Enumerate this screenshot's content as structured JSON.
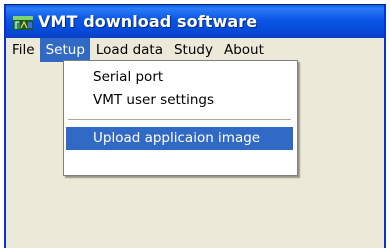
{
  "window": {
    "title": "VMT download software",
    "icon": "app-icon"
  },
  "menubar": {
    "items": [
      {
        "label": "File"
      },
      {
        "label": "Setup"
      },
      {
        "label": "Load data"
      },
      {
        "label": "Study"
      },
      {
        "label": "About"
      }
    ],
    "active": "Setup"
  },
  "setup_menu": {
    "items": [
      {
        "label": "Serial port"
      },
      {
        "label": "VMT user settings"
      },
      {
        "label": "Upload applicaion image"
      }
    ],
    "highlighted": "Upload applicaion image"
  },
  "colors": {
    "titlebar": "#0a55e6",
    "selection": "#316ac5",
    "window_bg": "#ece9d8"
  }
}
